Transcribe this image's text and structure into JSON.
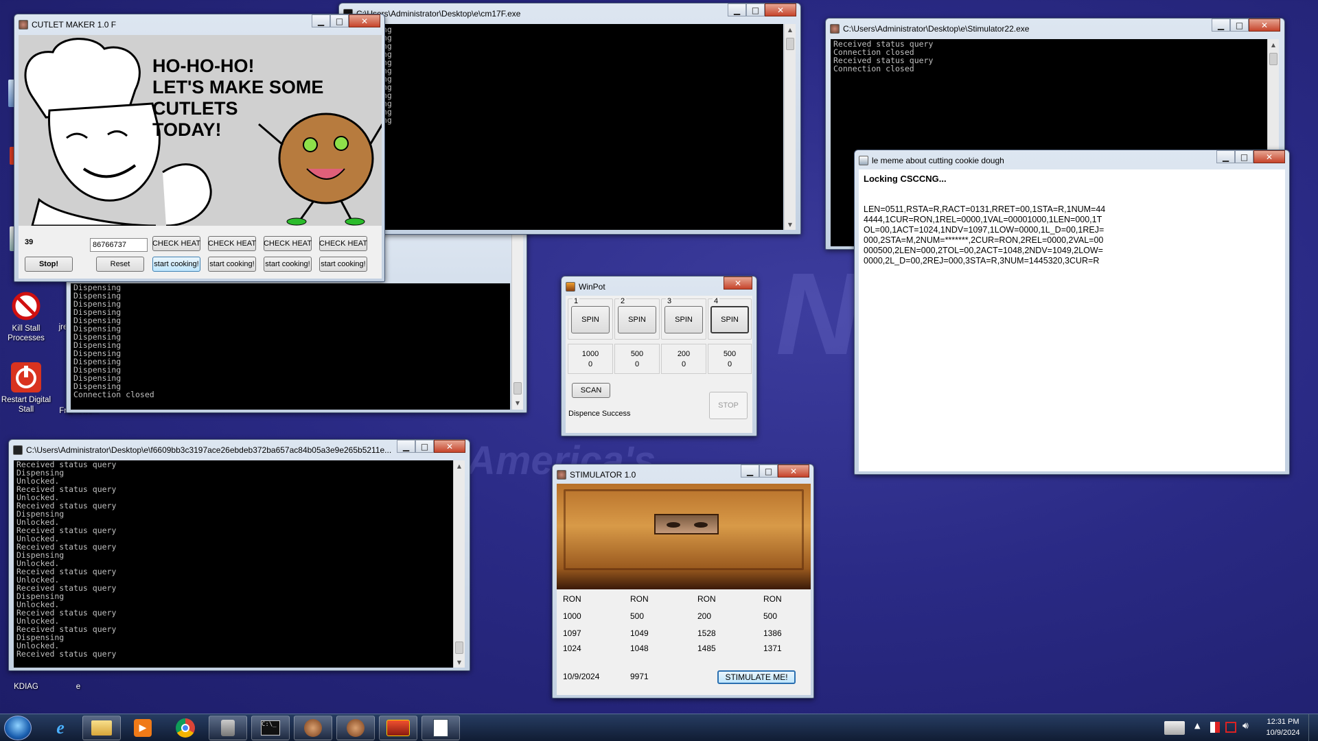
{
  "desktop": {
    "watermarks": [
      "NC",
      "America's"
    ],
    "icons": [
      {
        "label": "Kill Stall Processes",
        "icon": "no-sign-icon"
      },
      {
        "label": "Restart Digital Stall",
        "icon": "power-icon"
      },
      {
        "label": "jre",
        "icon": "folder-icon"
      },
      {
        "label": "Framewo...",
        "icon": "folder-icon"
      },
      {
        "label": "KDIAG",
        "icon": "app-icon"
      },
      {
        "label": "e",
        "icon": "folder-icon"
      }
    ]
  },
  "cm17f": {
    "title": "C:\\Users\\Administrator\\Desktop\\e\\cm17F.exe",
    "lines": "ng\nng\nng\nng\nng\nng\nng\nng\nng\nng\nng\nng"
  },
  "behind_console": {
    "lines": "Dispensing\nDispensing\nDispensing\nDispensing\nDispensing\nDispensing\nDispensing\nDispensing\nDispensing\nDispensing\nDispensing\nDispensing\nDispensing\nConnection closed"
  },
  "cutlet": {
    "title": "CUTLET MAKER 1.0 F",
    "headline": "HO-HO-HO!\nLET'S MAKE SOME\nCUTLETS\nTODAY!",
    "counter": "39",
    "code_value": "86766737",
    "stop_label": "Stop!",
    "reset_label": "Reset",
    "check_heat_label": "CHECK HEAT",
    "start_cooking_label": "start cooking!"
  },
  "stim22": {
    "title": "C:\\Users\\Administrator\\Desktop\\e\\Stimulator22.exe",
    "lines": "Received status query\nConnection closed\nReceived status query\nConnection closed"
  },
  "meme": {
    "title": "le meme about cutting cookie dough",
    "heading": "Locking CSCCNG...",
    "body": "LEN=0511,RSTA=R,RACT=0131,RRET=00,1STA=R,1NUM=44\n4444,1CUR=RON,1REL=0000,1VAL=00001000,1LEN=000,1T\nOL=00,1ACT=1024,1NDV=1097,1LOW=0000,1L_D=00,1REJ=\n000,2STA=M,2NUM=*******,2CUR=RON,2REL=0000,2VAL=00\n000500,2LEN=000,2TOL=00,2ACT=1048,2NDV=1049,2LOW=\n0000,2L_D=00,2REJ=000,3STA=R,3NUM=1445320,3CUR=R"
  },
  "winpot": {
    "title": "WinPot",
    "cassettes": [
      {
        "num": "1",
        "spin": "SPIN",
        "value": "1000",
        "count": "0"
      },
      {
        "num": "2",
        "spin": "SPIN",
        "value": "500",
        "count": "0"
      },
      {
        "num": "3",
        "spin": "SPIN",
        "value": "200",
        "count": "0"
      },
      {
        "num": "4",
        "spin": "SPIN",
        "value": "500",
        "count": "0"
      }
    ],
    "scan_label": "SCAN",
    "stop_label": "STOP",
    "status": "Dispence Success"
  },
  "hashcon": {
    "title": "C:\\Users\\Administrator\\Desktop\\e\\f6609bb3c3197ace26ebdeb372ba657ac84b05a3e9e265b5211e...",
    "lines": "Received status query\nDispensing\nUnlocked.\nReceived status query\nUnlocked.\nReceived status query\nDispensing\nUnlocked.\nReceived status query\nUnlocked.\nReceived status query\nDispensing\nUnlocked.\nReceived status query\nUnlocked.\nReceived status query\nDispensing\nUnlocked.\nReceived status query\nUnlocked.\nReceived status query\nDispensing\nUnlocked.\nReceived status query"
  },
  "stimulator": {
    "title": "STIMULATOR 1.0",
    "rows": [
      [
        "RON",
        "RON",
        "RON",
        "RON"
      ],
      [
        "1000",
        "500",
        "200",
        "500"
      ],
      [
        "1097",
        "1049",
        "1528",
        "1386"
      ],
      [
        "1024",
        "1048",
        "1485",
        "1371"
      ]
    ],
    "date": "10/9/2024",
    "code": "9971",
    "button_label": "STIMULATE ME!"
  },
  "taskbar": {
    "apps": [
      "start-orb-icon",
      "internet-explorer-icon",
      "explorer-folder-icon",
      "media-player-icon",
      "chrome-icon",
      "tool-icon",
      "cmd-icon",
      "cutlet-app-icon",
      "cutlet-app-icon",
      "slot-app-icon",
      "document-icon"
    ],
    "time": "12:31 PM",
    "date": "10/9/2024"
  }
}
